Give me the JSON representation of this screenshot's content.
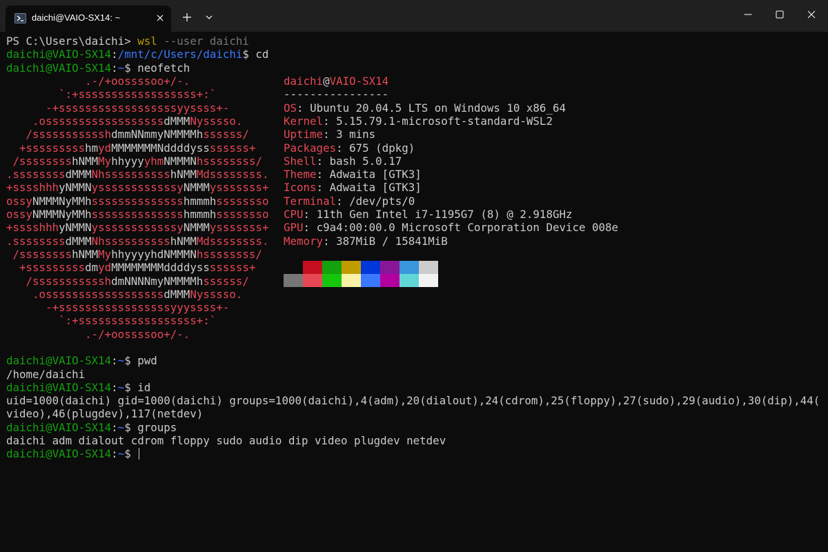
{
  "window": {
    "tab_title": "daichi@VAIO-SX14: ~"
  },
  "prompt": {
    "user_host": "daichi@VAIO-SX14",
    "sep": ":",
    "home": "~",
    "dollar": "$ "
  },
  "ps_line": {
    "prompt": "PS C:\\Users\\daichi> ",
    "cmd": "wsl",
    "args": " --user daichi"
  },
  "line2": {
    "path": "/mnt/c/Users/daichi",
    "cmd": "cd"
  },
  "line3": {
    "cmd": "neofetch"
  },
  "logo": {
    "lines": [
      "            .-/+oossssoo+/-.",
      "        `:+ssssssssssssssssss+:`",
      "      -+ssssssssssssssssssyyssss+-",
      "    .ossssssssssssssssssdMMMNysssso.",
      "   /ssssssssssshdmmNNmmyNMMMMhssssss/",
      "  +ssssssssshmydMMMMMMMNddddyssssssss+",
      " /sssssssshNMMMyhhyyyyhmNMMMNhssssssss/",
      ".ssssssssdMMMNhsssssssssshNMMMdssssssss.",
      "+sssshhhyNMMNyssssssssssssyNMMMysssssss+",
      "ossyNMMMNyMMhsssssssssssssshmmmhssssssso",
      "ossyNMMMNyMMhsssssssssssssshmmmhssssssso",
      "+sssshhhyNMMNyssssssssssssyNMMMysssssss+",
      ".ssssssssdMMMNhsssssssssshNMMMdssssssss.",
      " /sssssssshNMMMyhhyyyyhdNMMMNhssssssss/",
      "  +sssssssssdmydMMMMMMMMddddyssssssss+",
      "   /ssssssssssshdmNNNNmyNMMMMhssssss/",
      "    .ossssssssssssssssssdMMMNysssso.",
      "      -+sssssssssssssssssyyyssss+-",
      "        `:+ssssssssssssssssss+:`",
      "            .-/+oossssoo+/-."
    ]
  },
  "info": {
    "user": "daichi",
    "at": "@",
    "host": "VAIO-SX14",
    "divider": "----------------",
    "rows": [
      {
        "key": "OS",
        "value": "Ubuntu 20.04.5 LTS on Windows 10 x86_64"
      },
      {
        "key": "Kernel",
        "value": "5.15.79.1-microsoft-standard-WSL2"
      },
      {
        "key": "Uptime",
        "value": "3 mins"
      },
      {
        "key": "Packages",
        "value": "675 (dpkg)"
      },
      {
        "key": "Shell",
        "value": "bash 5.0.17"
      },
      {
        "key": "Theme",
        "value": "Adwaita [GTK3]"
      },
      {
        "key": "Icons",
        "value": "Adwaita [GTK3]"
      },
      {
        "key": "Terminal",
        "value": "/dev/pts/0"
      },
      {
        "key": "CPU",
        "value": "11th Gen Intel i7-1195G7 (8) @ 2.918GHz"
      },
      {
        "key": "GPU",
        "value": "c9a4:00:00.0 Microsoft Corporation Device 008e"
      },
      {
        "key": "Memory",
        "value": "387MiB / 15841MiB"
      }
    ],
    "colon": ": "
  },
  "palette": {
    "row1": [
      "#0c0c0c",
      "#c50f1f",
      "#13a10e",
      "#c19c00",
      "#0037da",
      "#881798",
      "#3a96dd",
      "#cccccc"
    ],
    "row2": [
      "#767676",
      "#e74856",
      "#16c60c",
      "#f9f1a5",
      "#3b78ff",
      "#b4009e",
      "#61d6d6",
      "#f2f2f2"
    ]
  },
  "pwd": {
    "cmd": "pwd",
    "output": "/home/daichi"
  },
  "id": {
    "cmd": "id",
    "output1": "uid=1000(daichi) gid=1000(daichi) groups=1000(daichi),4(adm),20(dialout),24(cdrom),25(floppy),27(sudo),29(audio),30(dip),44(",
    "output2": "video),46(plugdev),117(netdev)"
  },
  "groups": {
    "cmd": "groups",
    "output": "daichi adm dialout cdrom floppy sudo audio dip video plugdev netdev"
  }
}
